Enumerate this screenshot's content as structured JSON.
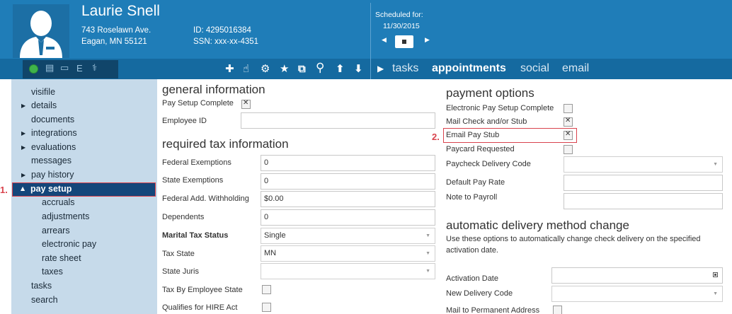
{
  "header": {
    "employee_name": "Laurie Snell",
    "address_line1": "743 Roselawn Ave.",
    "address_line2": "Eagan, MN 55121",
    "id_text": "ID: 4295016384",
    "ssn_text": "SSN: xxx-xx-4351",
    "scheduled_label": "Scheduled for:",
    "scheduled_date": "11/30/2015",
    "status_color": "#3fb34a",
    "toolbar_icons": [
      "status-dot",
      "document-icon",
      "card-icon",
      "e-icon",
      "caduceus-icon"
    ],
    "action_icons": [
      "plus-icon",
      "pointer-icon",
      "gear-icon",
      "star-icon",
      "external-link-icon",
      "search-icon",
      "arrow-up-icon",
      "arrow-down-icon"
    ],
    "nav": {
      "tasks": "tasks",
      "appointments": "appointments",
      "social": "social",
      "email": "email"
    }
  },
  "sidebar": {
    "items": {
      "visifile": "visifile",
      "details": "details",
      "documents": "documents",
      "integrations": "integrations",
      "evaluations": "evaluations",
      "messages": "messages",
      "pay_history": "pay history",
      "pay_setup": "pay setup",
      "accruals": "accruals",
      "adjustments": "adjustments",
      "arrears": "arrears",
      "electronic_pay": "electronic pay",
      "rate_sheet": "rate sheet",
      "taxes": "taxes",
      "tasks": "tasks",
      "search": "search"
    },
    "active_item": "pay setup",
    "callout_1": "1."
  },
  "general": {
    "title": "general information",
    "pay_setup_complete": "Pay Setup Complete",
    "pay_setup_complete_checked": true,
    "employee_id": "Employee ID",
    "employee_id_value": ""
  },
  "tax": {
    "title": "required tax information",
    "federal_exemptions": "Federal Exemptions",
    "federal_exemptions_value": "0",
    "state_exemptions": "State Exemptions",
    "state_exemptions_value": "0",
    "federal_add_withholding": "Federal Add. Withholding",
    "federal_add_withholding_value": "$0.00",
    "dependents": "Dependents",
    "dependents_value": "0",
    "marital_tax_status": "Marital Tax Status",
    "marital_tax_status_value": "Single",
    "tax_state": "Tax State",
    "tax_state_value": "MN",
    "state_juris": "State Juris",
    "state_juris_value": "",
    "tax_by_employee_state": "Tax By Employee State",
    "qualifies_for_hire_act": "Qualifies for HIRE Act"
  },
  "payment": {
    "title": "payment options",
    "electronic_pay_setup_complete": "Electronic Pay Setup Complete",
    "mail_check_stub": "Mail Check and/or Stub",
    "mail_check_stub_checked": true,
    "email_pay_stub": "Email Pay Stub",
    "email_pay_stub_checked": true,
    "callout_2": "2.",
    "paycard_requested": "Paycard Requested",
    "paycheck_delivery_code": "Paycheck Delivery Code",
    "paycheck_delivery_code_value": "",
    "default_pay_rate": "Default Pay Rate",
    "default_pay_rate_value": "",
    "note_to_payroll": "Note to Payroll",
    "note_to_payroll_value": ""
  },
  "auto_delivery": {
    "title": "automatic delivery method change",
    "description_line1": "Use these options to automatically change check delivery on the specified",
    "description_line2": "activation date.",
    "activation_date": "Activation Date",
    "activation_date_value": "",
    "new_delivery_code": "New Delivery Code",
    "new_delivery_code_value": "",
    "mail_to_permanent_address": "Mail to Permanent Address"
  },
  "colors": {
    "header_blue": "#1f7db8",
    "toolbar_blue": "#156aa0",
    "sidebar_bg": "#c6daea",
    "active_nav": "#14467a",
    "callout_red": "#d9434d"
  }
}
